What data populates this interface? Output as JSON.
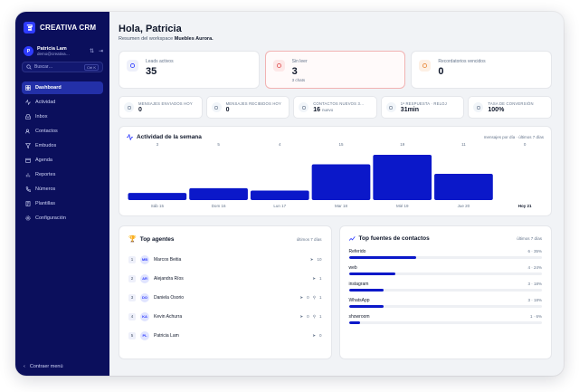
{
  "brand": {
    "name": "CREATIVA CRM"
  },
  "user": {
    "initial": "P",
    "name": "Patricia Lam",
    "email": "demo@creativa…"
  },
  "search": {
    "placeholder": "Buscar…",
    "shortcut": "Ctrl K"
  },
  "nav": [
    {
      "label": "Dashboard",
      "icon": "dashboard-icon",
      "active": true
    },
    {
      "label": "Actividad",
      "icon": "activity-icon"
    },
    {
      "label": "Inbox",
      "icon": "inbox-icon"
    },
    {
      "label": "Contactos",
      "icon": "contacts-icon"
    },
    {
      "label": "Embudos",
      "icon": "funnel-icon"
    },
    {
      "label": "Agenda",
      "icon": "calendar-icon"
    },
    {
      "label": "Reportes",
      "icon": "reports-icon"
    },
    {
      "label": "Números",
      "icon": "phone-icon"
    },
    {
      "label": "Plantillas",
      "icon": "template-icon"
    },
    {
      "label": "Configuración",
      "icon": "settings-icon"
    }
  ],
  "collapse_label": "Contraer menú",
  "header": {
    "greeting": "Hola, Patricia",
    "subtitle_prefix": "Resumen del workspace",
    "workspace": "Muebles Aurora."
  },
  "kpis": [
    {
      "label": "Leads activos",
      "value": "35",
      "sub": "",
      "icon": "leads-icon"
    },
    {
      "label": "Sin leer",
      "value": "3",
      "sub": "3 chats",
      "icon": "unread-icon"
    },
    {
      "label": "Recordatorios vencidos",
      "value": "0",
      "sub": "",
      "icon": "reminder-icon"
    }
  ],
  "stats": [
    {
      "label": "MENSAJES ENVIADOS HOY",
      "value": "0",
      "sub": "",
      "icon": "send-icon"
    },
    {
      "label": "MENSAJES RECIBIDOS HOY",
      "value": "0",
      "sub": "",
      "icon": "message-icon"
    },
    {
      "label": "CONTACTOS NUEVOS 3…",
      "value": "16",
      "sub": "nuevo",
      "icon": "users-icon"
    },
    {
      "label": "1ª RESPUESTA · RELOJ",
      "value": "31min",
      "sub": "",
      "icon": "clock-icon"
    },
    {
      "label": "TASA DE CONVERSIÓN",
      "value": "100%",
      "sub": "",
      "icon": "target-icon"
    }
  ],
  "activity": {
    "title": "Actividad de la semana",
    "hint": "mensajes por día · últimos 7 días"
  },
  "chart_data": {
    "type": "bar",
    "categories": [
      "Sáb 15",
      "Dom 16",
      "Lun 17",
      "Mar 18",
      "Mié 19",
      "Jue 20",
      "Hoy 21"
    ],
    "values": [
      3,
      5,
      4,
      15,
      19,
      11,
      0
    ],
    "highlight": "Hoy 21",
    "bar_color": "#0b18c9"
  },
  "agents_panel": {
    "title": "Top agentes",
    "hint": "últimos 7 días"
  },
  "agents": [
    {
      "rank": "1",
      "initials": "MB",
      "name": "Marcos Beitia",
      "sent": "10",
      "leads": ""
    },
    {
      "rank": "2",
      "initials": "AR",
      "name": "Alejandra Ríos",
      "sent": "1",
      "leads": ""
    },
    {
      "rank": "3",
      "initials": "DO",
      "name": "Daniela Osorio",
      "sent": "0",
      "leads": "1"
    },
    {
      "rank": "4",
      "initials": "KA",
      "name": "Kevin Achurra",
      "sent": "0",
      "leads": "1"
    },
    {
      "rank": "5",
      "initials": "PL",
      "name": "Patricia Lam",
      "sent": "0",
      "leads": ""
    }
  ],
  "sources_panel": {
    "title": "Top fuentes de contactos",
    "hint": "últimos 7 días"
  },
  "sources": [
    {
      "name": "Referido",
      "value": "6 · 35%",
      "pct": 35
    },
    {
      "name": "web",
      "value": "4 · 24%",
      "pct": 24
    },
    {
      "name": "instagram",
      "value": "3 · 18%",
      "pct": 18
    },
    {
      "name": "WhatsApp",
      "value": "3 · 18%",
      "pct": 18
    },
    {
      "name": "showroom",
      "value": "1 · 6%",
      "pct": 6
    }
  ]
}
